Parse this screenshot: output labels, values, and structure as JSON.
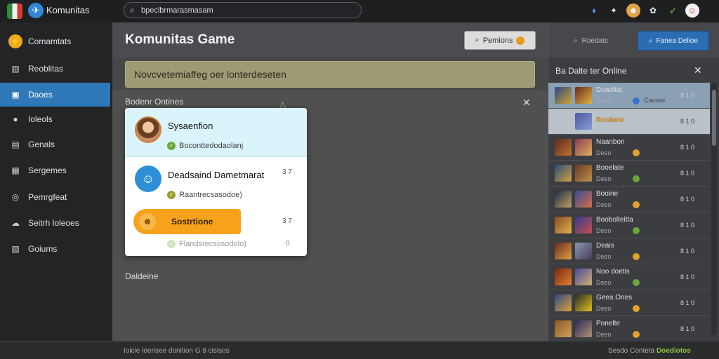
{
  "topbar": {
    "app_title": "Komunitas",
    "search_value": "bpeclbrmarasmasam"
  },
  "sidebar": {
    "items": [
      {
        "label": "Comamtats",
        "icon": "coin-icon"
      },
      {
        "label": "Reoblitas",
        "icon": "grid-icon"
      },
      {
        "label": "Daoes",
        "icon": "inbox-icon",
        "active": true
      },
      {
        "label": "Ioleols",
        "icon": "chat-icon"
      },
      {
        "label": "Genals",
        "icon": "document-icon"
      },
      {
        "label": "Sergemes",
        "icon": "news-icon"
      },
      {
        "label": "Pemrgfeat",
        "icon": "target-icon"
      },
      {
        "label": "Seitrh loleoes",
        "icon": "cloud-icon"
      },
      {
        "label": "Goiums",
        "icon": "stack-icon"
      }
    ]
  },
  "main": {
    "title": "Komunitas Game",
    "pemions_button": "Pemions",
    "notice": "Novcvetemiaffeg oer lonterdeseten",
    "section1": "Bodenr Ontines",
    "section2": "Daldeine"
  },
  "popup": {
    "rows": [
      {
        "name": "Sysaenfion",
        "status": "Boconttedodaolanj"
      },
      {
        "name": "Deadsaind Dametmarat",
        "status": "Raantrecsasodoe)",
        "count": "3 7"
      },
      {
        "button": "Sostrtione",
        "status": "Flandsrecsosodolo)",
        "count": "3 7",
        "count2": "0"
      }
    ]
  },
  "rightpanel": {
    "tab": "Roedats",
    "button": "Fanea Delioe",
    "title": "Ba Dalte ter Online",
    "items": [
      {
        "name": "Doaditat",
        "sub": "Deeo",
        "badge": "Ciaosio",
        "count": "8 1 0",
        "dot": "#3b6fd0"
      },
      {
        "name": "Roobele",
        "sub": "",
        "badge": "",
        "count": "8 1 0",
        "orange": true
      },
      {
        "name": "Naanbon",
        "sub": "Deeo",
        "badge": "",
        "count": "8 1 0",
        "dot": "#e0a22a"
      },
      {
        "name": "Booelate",
        "sub": "Deeo",
        "badge": "",
        "count": "8 1 0",
        "dot": "#6aa83a"
      },
      {
        "name": "Booine",
        "sub": "Deeo",
        "badge": "",
        "count": "8 1 0",
        "dot": "#e0a22a"
      },
      {
        "name": "Boobolteitta",
        "sub": "Deeo",
        "badge": "",
        "count": "8 1 0",
        "dot": "#6aa83a"
      },
      {
        "name": "Deais",
        "sub": "Deeo",
        "badge": "",
        "count": "8 1 0",
        "dot": "#e0a22a"
      },
      {
        "name": "Noo doetis",
        "sub": "Deeo",
        "badge": "",
        "count": "8 1 0",
        "dot": "#6aa83a"
      },
      {
        "name": "Geea Ones",
        "sub": "Deeo",
        "badge": "",
        "count": "8 1 0",
        "dot": "#e0a22a"
      },
      {
        "name": "Ponelte",
        "sub": "Deeo",
        "badge": "",
        "count": "8 1 0",
        "dot": "#e0a22a"
      }
    ]
  },
  "footer": {
    "left": "Ioicie loerisee donition G 8 cisisos",
    "right_plain": "Sesdo Conteta",
    "right_accent": "Doediotos"
  }
}
